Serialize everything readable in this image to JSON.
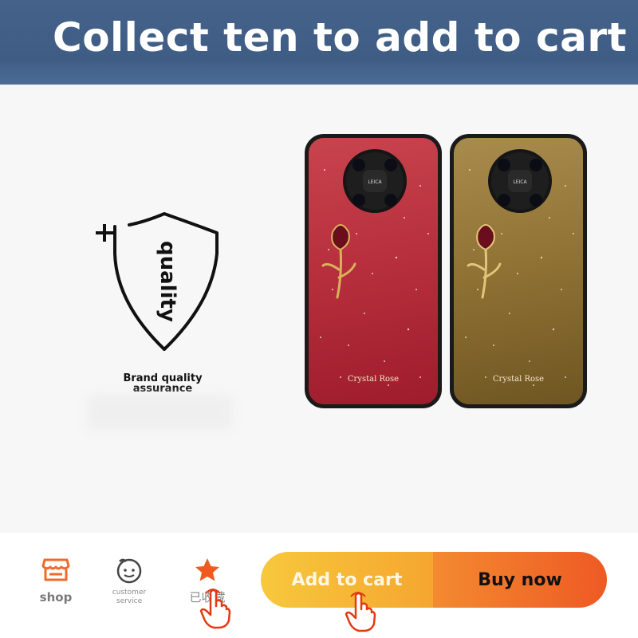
{
  "banner": {
    "title": "Collect ten to add to cart"
  },
  "promo": {
    "shield_word": "quality",
    "brand_line1": "Brand quality",
    "brand_line2": "assurance"
  },
  "products": [
    {
      "variant": "red",
      "caption": "Crystal Rose",
      "camera_brand": "LEICA"
    },
    {
      "variant": "gold",
      "caption": "Crystal Rose",
      "camera_brand": "LEICA"
    }
  ],
  "bottom_nav": {
    "shop_label": "shop",
    "service_label": "customer service",
    "favorite_label": "已收藏"
  },
  "actions": {
    "add_to_cart": "Add to cart",
    "buy_now": "Buy now"
  },
  "colors": {
    "banner": "#44628a",
    "shop_icon": "#f06a2a",
    "favorite_star": "#f05a1e",
    "add_to_cart": "#f7b836",
    "buy_now": "#ee5a24"
  },
  "icons": [
    "shop-icon",
    "customer-service-icon",
    "star-icon",
    "pointer-hand-icon"
  ]
}
